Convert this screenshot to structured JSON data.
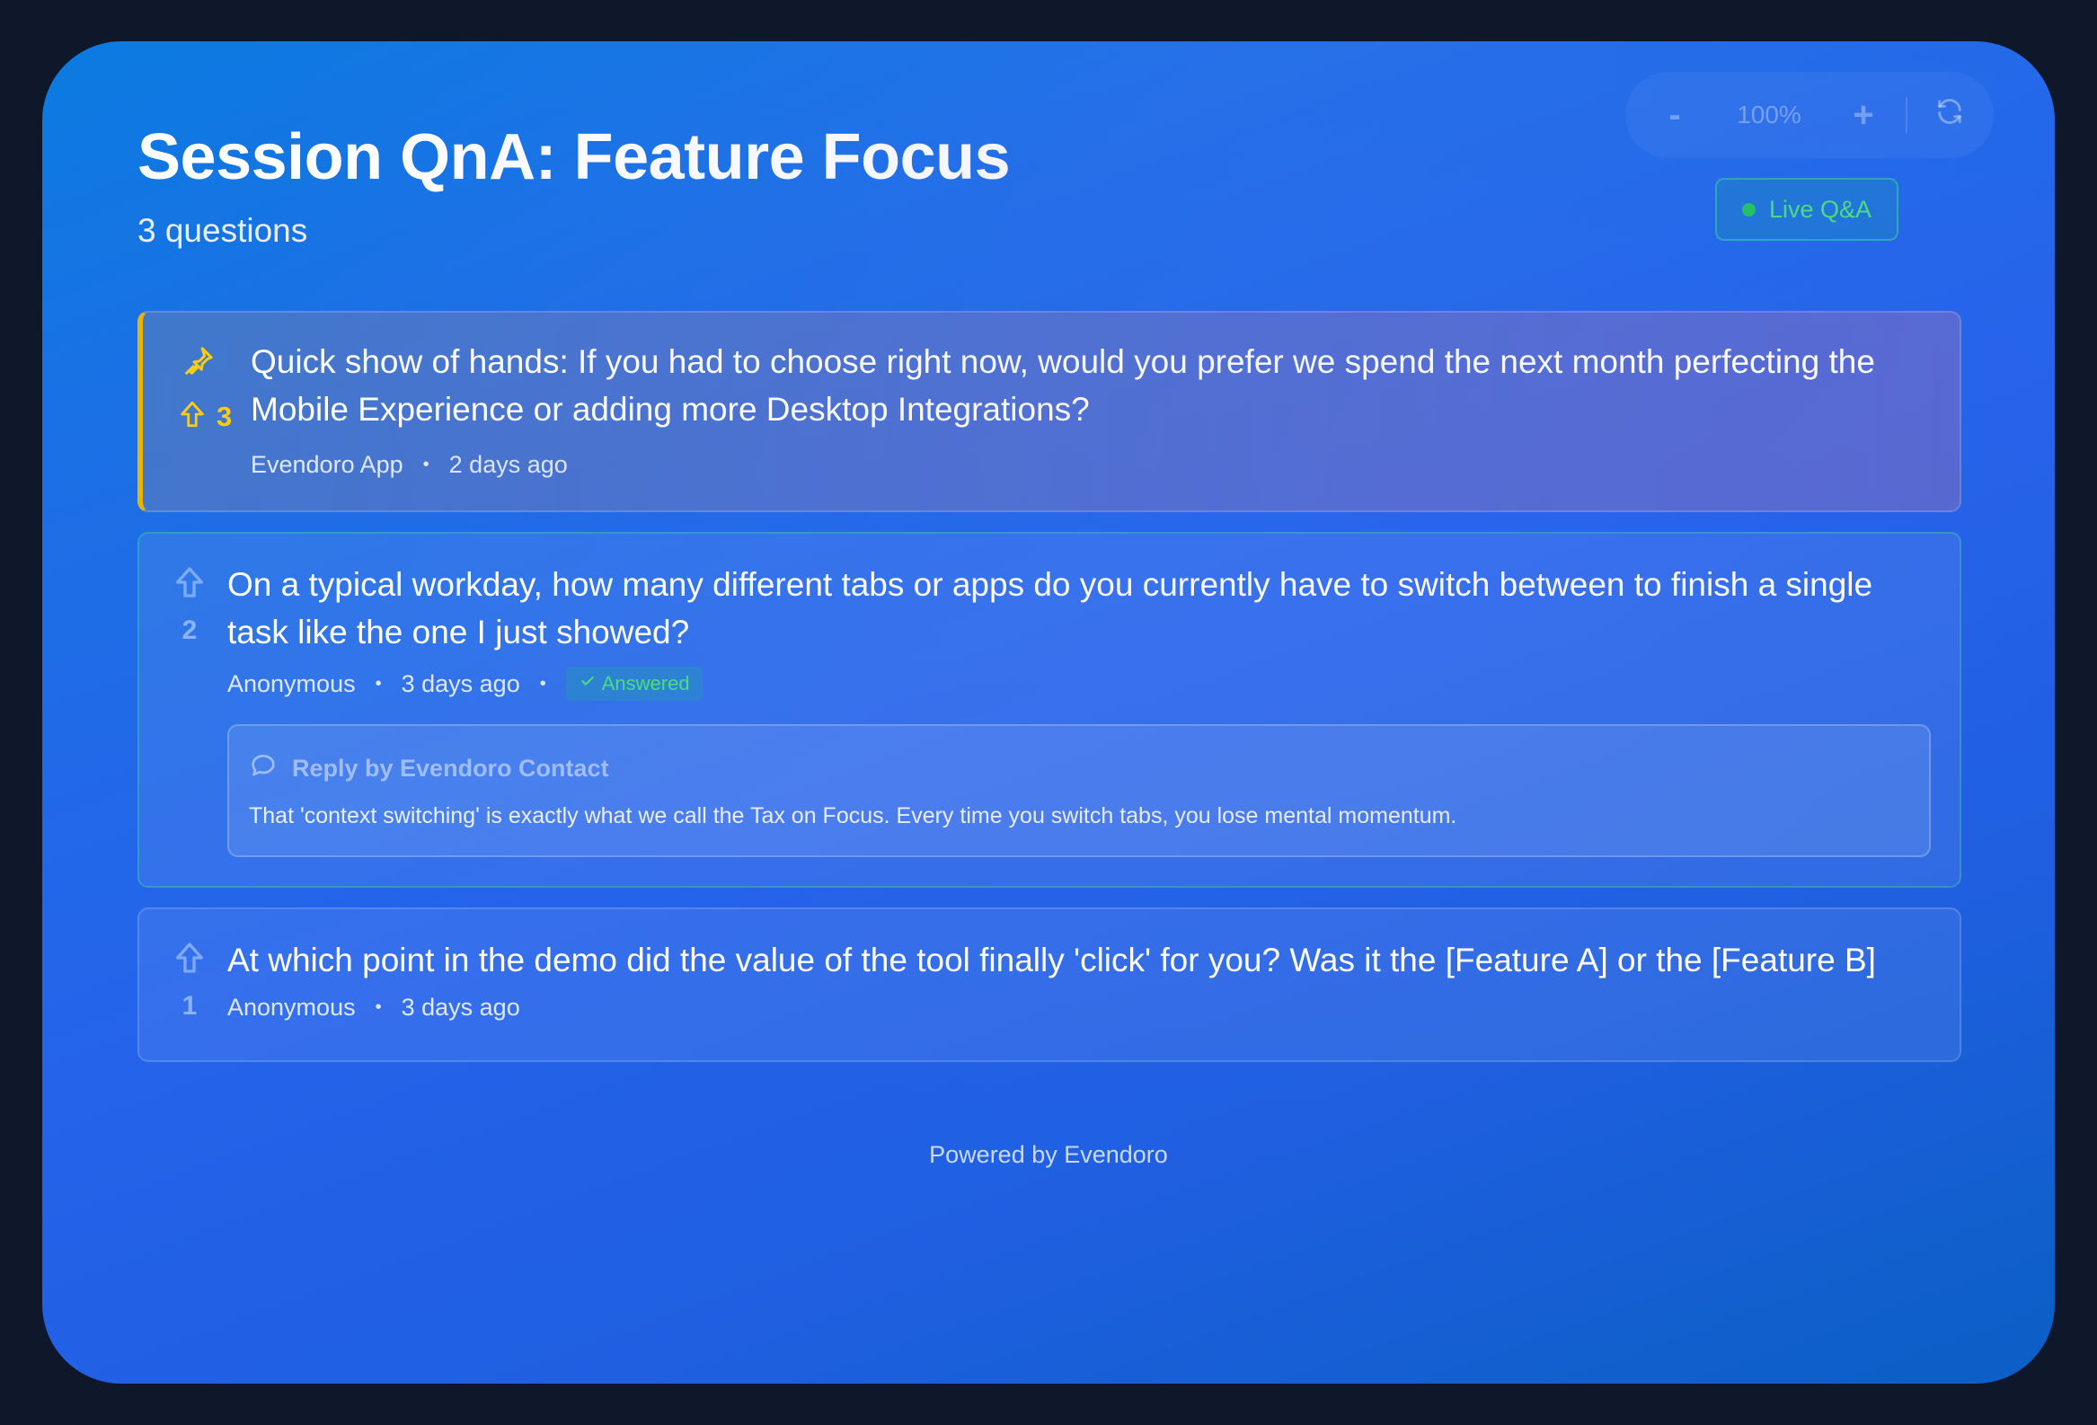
{
  "header": {
    "title": "Session QnA: Feature Focus",
    "subtitle": "3 questions"
  },
  "zoom": {
    "minus_label": "-",
    "level": "100%",
    "plus_label": "+",
    "reset_icon": "refresh-icon"
  },
  "live_badge": {
    "label": "Live Q&A",
    "color": "#22c55e"
  },
  "questions": [
    {
      "text": "Quick show of hands: If you had to choose right now, would you prefer we spend the next month perfecting the Mobile Experience or adding more Desktop Integrations?",
      "author": "Evendoro App",
      "time": "2 days ago",
      "votes": "3",
      "pinned": true,
      "accent": "#eab308"
    },
    {
      "text": "On a typical workday, how many different tabs or apps do you currently have to switch between to finish a single task like the one I just showed?",
      "author": "Anonymous",
      "time": "3 days ago",
      "votes": "2",
      "status": "Answered",
      "reply": {
        "heading": "Reply by Evendoro Contact",
        "text": "That 'context switching' is exactly what we call the Tax on Focus. Every time you switch tabs, you lose mental momentum."
      }
    },
    {
      "text": "At which point in the demo did the value of the tool finally 'click' for you? Was it the [Feature A] or the [Feature B]",
      "author": "Anonymous",
      "time": "3 days ago",
      "votes": "1"
    }
  ],
  "separator": "•",
  "footer": {
    "text": "Powered by Evendoro"
  }
}
